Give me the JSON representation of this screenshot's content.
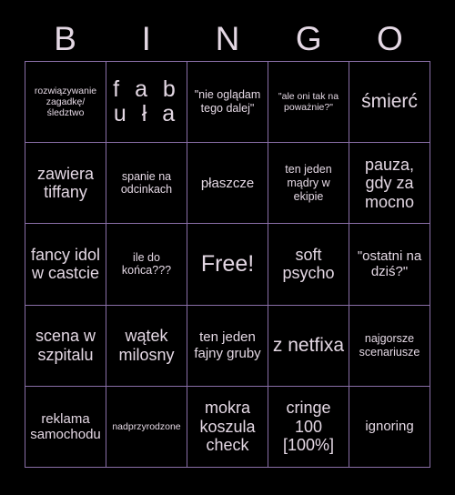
{
  "header": {
    "letters": [
      "B",
      "I",
      "N",
      "G",
      "O"
    ]
  },
  "grid": {
    "rows": 5,
    "columns": 5,
    "border_color": "#8a6fa8",
    "background_color": "#000000",
    "text_color": "#e4d8e4",
    "free_space_index": 12,
    "cells": [
      {
        "text": "rozwiązywanie zagadkę/ śledztwo",
        "size": "xs"
      },
      {
        "text": "f a b\nu ł a",
        "size": "xxl",
        "tracked": true
      },
      {
        "text": "\"nie oglądam tego dalej\"",
        "size": "sm"
      },
      {
        "text": "\"ale oni tak na poważnie?\"",
        "size": "xs"
      },
      {
        "text": "śmierć",
        "size": "xl"
      },
      {
        "text": "zawiera tiffany",
        "size": "lg"
      },
      {
        "text": "spanie na odcinkach",
        "size": "sm"
      },
      {
        "text": "płaszcze",
        "size": "md"
      },
      {
        "text": "ten jeden mądry w ekipie",
        "size": "sm"
      },
      {
        "text": "pauza, gdy za mocno",
        "size": "lg"
      },
      {
        "text": "fancy idol w castcie",
        "size": "lg"
      },
      {
        "text": "ile do końca???",
        "size": "sm"
      },
      {
        "text": "Free!",
        "size": "xxl"
      },
      {
        "text": "soft psycho",
        "size": "lg"
      },
      {
        "text": "\"ostatni na dziś?\"",
        "size": "md"
      },
      {
        "text": "scena w szpitalu",
        "size": "lg"
      },
      {
        "text": "wątek milosny",
        "size": "lg"
      },
      {
        "text": "ten jeden fajny gruby",
        "size": "md"
      },
      {
        "text": "z netfixa",
        "size": "xl"
      },
      {
        "text": "najgorsze scenariusze",
        "size": "sm"
      },
      {
        "text": "reklama samochodu",
        "size": "md"
      },
      {
        "text": "nadprzyrodzone",
        "size": "xs"
      },
      {
        "text": "mokra koszula check",
        "size": "lg"
      },
      {
        "text": "cringe 100 [100%]",
        "size": "lg"
      },
      {
        "text": "ignoring",
        "size": "md"
      }
    ]
  }
}
